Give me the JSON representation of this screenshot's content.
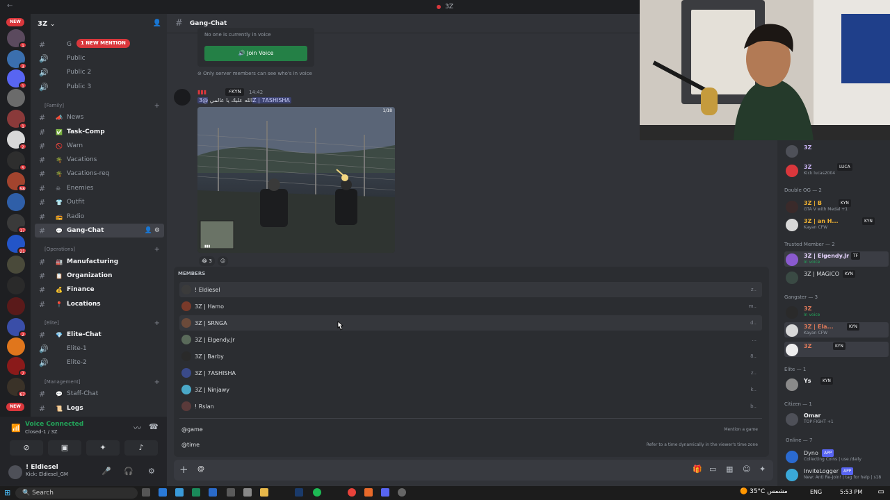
{
  "titlebar": {
    "title": "3Z"
  },
  "server_rail": {
    "new_badges": [
      "NEW",
      "NEW"
    ],
    "badges": [
      "1",
      "3",
      "1",
      "1",
      "2",
      "5",
      "58",
      "17",
      "21",
      "2",
      "7",
      "67"
    ]
  },
  "sidebar": {
    "server_name": "3Z",
    "new_mention": "1 NEW MENTION",
    "voice_channels": [
      {
        "emoji": "",
        "label": "G"
      },
      {
        "emoji": "",
        "label": "Public"
      },
      {
        "emoji": "",
        "label": "Public 2"
      },
      {
        "emoji": "",
        "label": "Public 3"
      }
    ],
    "categories": [
      "[Family]",
      "[Operations]",
      "[Elite]",
      "[Management]"
    ],
    "channels_family": [
      {
        "emoji": "📣",
        "label": "News"
      },
      {
        "emoji": "✅",
        "label": "Task-Comp"
      },
      {
        "emoji": "🚫",
        "label": "Warn"
      },
      {
        "emoji": "🌴",
        "label": "Vacations"
      },
      {
        "emoji": "🌴",
        "label": "Vacations-req"
      },
      {
        "emoji": "☠",
        "label": "Enemies"
      },
      {
        "emoji": "👕",
        "label": "Outfit"
      },
      {
        "emoji": "📻",
        "label": "Radio"
      },
      {
        "emoji": "💬",
        "label": "Gang-Chat"
      }
    ],
    "channels_operations": [
      {
        "emoji": "🏭",
        "label": "Manufacturing"
      },
      {
        "emoji": "📋",
        "label": "Organization"
      },
      {
        "emoji": "💰",
        "label": "Finance"
      },
      {
        "emoji": "📍",
        "label": "Locations"
      }
    ],
    "channels_elite": [
      {
        "emoji": "💎",
        "label": "Elite-Chat"
      },
      {
        "emoji": "",
        "label": "Elite-1"
      },
      {
        "emoji": "",
        "label": "Elite-2"
      }
    ],
    "channels_management": [
      {
        "emoji": "💬",
        "label": "Staff-Chat"
      },
      {
        "emoji": "📜",
        "label": "Logs"
      }
    ]
  },
  "voice_panel": {
    "status": "Voice Connected",
    "channel": "Closed-1 / 3Z"
  },
  "user_panel": {
    "name": "! Eldiesel",
    "status": "Kick: Eldiesel_GM"
  },
  "chat": {
    "channel_title": "Gang-Chat",
    "voice_box_text": "No one is currently in voice",
    "join_button": "Join Voice",
    "voice_note": "Only server members can see who's in voice",
    "message": {
      "tag": "KYN",
      "time": "14:42",
      "text": "الله عليك يا عالمي",
      "mention": "@3Z | 7ASHISHA"
    },
    "image_count": "1/18",
    "reaction_count": "3"
  },
  "autocomplete": {
    "header": "MEMBERS",
    "members": [
      {
        "name": "! Eldiesel",
        "right": "z.."
      },
      {
        "name": "3Z | Hamo",
        "right": "m.."
      },
      {
        "name": "3Z | SRNGA",
        "right": "d.."
      },
      {
        "name": "3Z | Elgendy.Jr",
        "right": "..."
      },
      {
        "name": "3Z | Barby",
        "right": "8.."
      },
      {
        "name": "3Z | 7ASHISHA",
        "right": "z.."
      },
      {
        "name": "3Z | Ninjawy",
        "right": "k.."
      },
      {
        "name": "! Rslan",
        "right": "b.."
      }
    ],
    "commands": [
      {
        "name": "@game",
        "desc": "Mention a game"
      },
      {
        "name": "@time",
        "desc": "Refer to a time dynamically in the viewer's time zone"
      }
    ]
  },
  "input": {
    "value": "@"
  },
  "member_list": {
    "top": [
      {
        "name": "3Z",
        "sub": "",
        "badge": ""
      },
      {
        "name": "3Z",
        "sub": "Kick lucas2004",
        "badge": "LUCA"
      }
    ],
    "groups": [
      {
        "title": "Double OG",
        "count": "2",
        "members": [
          {
            "name": "3Z | B",
            "sub": "GTA V with Medal +1",
            "badge": "KYN"
          },
          {
            "name": "3Z | an H...",
            "sub": "Kayan CFW",
            "badge": "KYN"
          }
        ]
      },
      {
        "title": "Trusted Member",
        "count": "2",
        "members": [
          {
            "name": "3Z | Elgendy.Jr",
            "sub": "In voice",
            "badge": "TF"
          },
          {
            "name": "3Z | MAGICO",
            "sub": "",
            "badge": "KYN"
          }
        ]
      },
      {
        "title": "Gangster",
        "count": "3",
        "members": [
          {
            "name": "3Z",
            "sub": "In voice",
            "badge": ""
          },
          {
            "name": "3Z | Ela...",
            "sub": "Kayan CFW",
            "badge": "KYN"
          },
          {
            "name": "3Z",
            "sub": "",
            "badge": "KYN"
          }
        ]
      },
      {
        "title": "Elite",
        "count": "1",
        "members": [
          {
            "name": "Ys",
            "sub": "",
            "badge": "KYN"
          }
        ]
      },
      {
        "title": "Citizen",
        "count": "1",
        "members": [
          {
            "name": "Omar",
            "sub": "TOP FIGHT +1",
            "badge": ""
          }
        ]
      }
    ],
    "online_header": "Online — 7",
    "online": [
      {
        "name": "Dyno",
        "sub": "Collecting Coins | use /daily",
        "badge": "APP"
      },
      {
        "name": "InviteLogger",
        "sub": "New: Anti Re-Join! | tag for help | s18",
        "badge": "APP"
      }
    ]
  },
  "taskbar": {
    "search": "Search",
    "weather": "35°C  مشمس",
    "lang": "ENG",
    "time": "5:53 PM"
  },
  "colors": {
    "accent": "#5865f2",
    "green": "#248046",
    "red": "#da373c",
    "online": "#23a55a"
  }
}
